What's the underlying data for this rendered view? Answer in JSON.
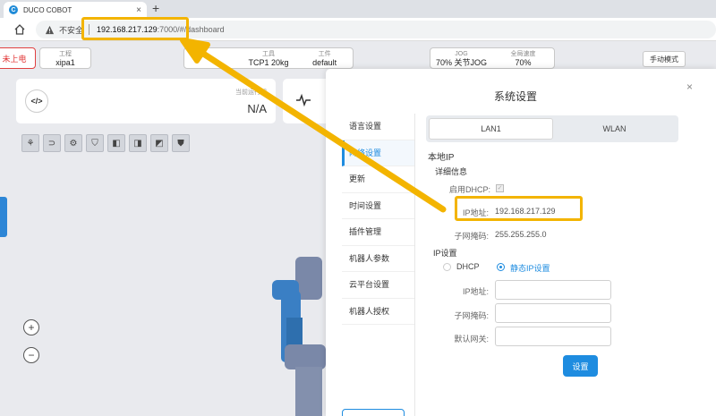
{
  "browser": {
    "tab_title": "DUCO COBOT",
    "tab_close": "×",
    "new_tab": "+",
    "insecure_label": "不安全",
    "url_host": "192.168.217.129",
    "url_rest": ":7000/#/dashboard",
    "favicon_letter": "C"
  },
  "toolbar": {
    "power_label": "未上电",
    "project_label": "工程",
    "project_value": "xipa1",
    "tool_col1_label": "",
    "tool_col1_value": "",
    "tool_label": "工具",
    "tool_value": "TCP1 20kg",
    "workpiece_label": "工件",
    "workpiece_value": "default",
    "jog_label": "JOG",
    "jog_speed": "70%",
    "jog_mode": "关节JOG",
    "global_speed_label": "全局速度",
    "global_speed": "70%",
    "manual_mode": "手动模式"
  },
  "dashboard": {
    "current_label": "当前运行程",
    "current_value": "N/A",
    "code_icon_text": "</>",
    "zoom_in": "+",
    "zoom_out": "−",
    "view_icons": [
      "⚘",
      "⊃",
      "⚙",
      "⛉",
      "◧",
      "◨",
      "◩",
      "⛊"
    ]
  },
  "modal": {
    "title": "系统设置",
    "close": "×",
    "menu": [
      "语言设置",
      "网络设置",
      "更新",
      "时间设置",
      "插件管理",
      "机器人参数",
      "云平台设置",
      "机器人授权"
    ],
    "active_menu_index": 1,
    "tabs": [
      "LAN1",
      "WLAN"
    ],
    "active_tab": "LAN1",
    "section_local_ip": "本地IP",
    "detail_title": "详细信息",
    "dhcp_label": "启用DHCP:",
    "dhcp_checked": true,
    "ip_label": "IP地址:",
    "ip_value": "192.168.217.129",
    "mask_label": "子网掩码:",
    "mask_value": "255.255.255.0",
    "ip_setting_title": "IP设置",
    "radio_dhcp": "DHCP",
    "radio_static": "静态IP设置",
    "selected_mode": "静态IP设置",
    "form_ip_label": "IP地址:",
    "form_mask_label": "子网掩码:",
    "form_gateway_label": "默认网关:",
    "form_ip_value": "",
    "form_mask_value": "",
    "form_gateway_value": "",
    "set_button": "设置"
  },
  "colors": {
    "accent": "#1e8ce0",
    "highlight": "#f3b400",
    "danger": "#e03030"
  }
}
